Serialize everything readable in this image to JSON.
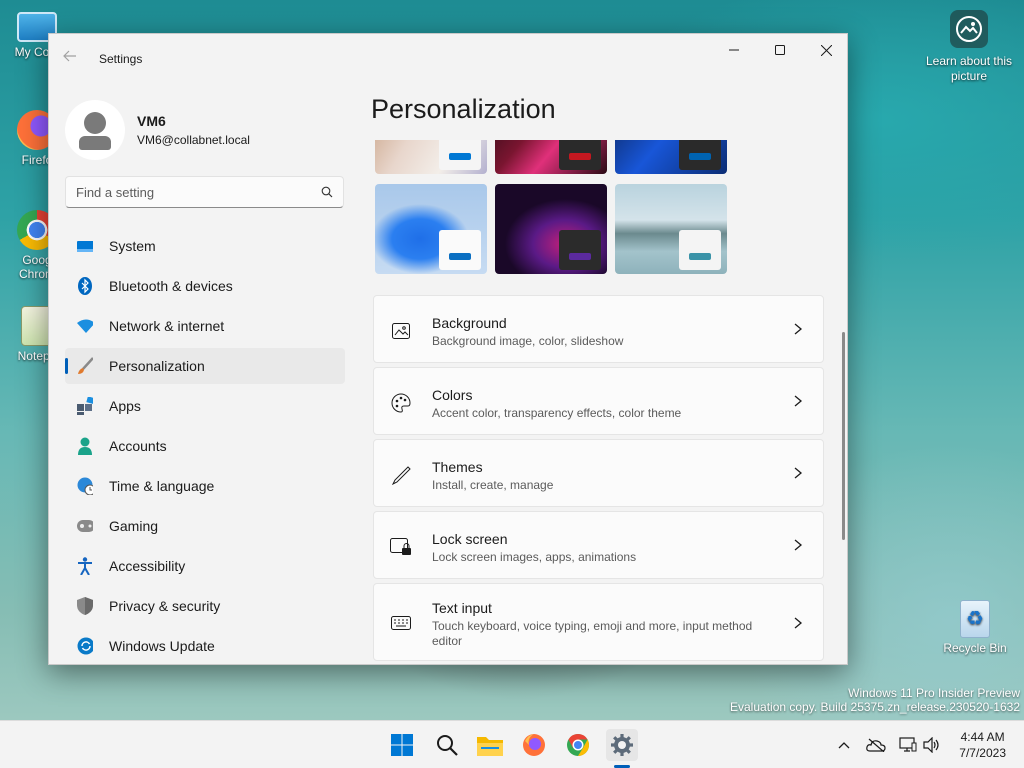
{
  "desktop": {
    "icons": [
      {
        "label": "My Com"
      },
      {
        "label": "Firefo"
      },
      {
        "label": "Goog"
      },
      {
        "label": "Chrom"
      },
      {
        "label": "Notepa"
      }
    ],
    "learn_label": "Learn about this picture",
    "recycle_label": "Recycle Bin",
    "watermark_line1": "Windows 11 Pro Insider Preview",
    "watermark_line2": "Evaluation copy. Build 25375.zn_release.230520-1632"
  },
  "window": {
    "title": "Settings",
    "controls": {
      "minimize": "minimize-icon",
      "maximize": "maximize-icon",
      "close": "close-icon"
    }
  },
  "profile": {
    "name": "VM6",
    "email": "VM6@collabnet.local"
  },
  "search": {
    "placeholder": "Find a setting"
  },
  "nav": {
    "items": [
      {
        "label": "System",
        "icon": "system-icon",
        "color": "#0078d4"
      },
      {
        "label": "Bluetooth & devices",
        "icon": "bluetooth-icon",
        "color": "#0067c0"
      },
      {
        "label": "Network & internet",
        "icon": "wifi-icon",
        "color": "#1b8fe0"
      },
      {
        "label": "Personalization",
        "icon": "brush-icon",
        "color": "#e07a2e"
      },
      {
        "label": "Apps",
        "icon": "apps-icon",
        "color": "#4a5b70"
      },
      {
        "label": "Accounts",
        "icon": "accounts-icon",
        "color": "#1aa38a"
      },
      {
        "label": "Time & language",
        "icon": "globe-clock-icon",
        "color": "#2b88d8"
      },
      {
        "label": "Gaming",
        "icon": "gamepad-icon",
        "color": "#6e6e6e"
      },
      {
        "label": "Accessibility",
        "icon": "accessibility-icon",
        "color": "#1565c0"
      },
      {
        "label": "Privacy & security",
        "icon": "shield-icon",
        "color": "#7b7b7b"
      },
      {
        "label": "Windows Update",
        "icon": "update-icon",
        "color": "#0a7ac8"
      }
    ],
    "active_index": 3
  },
  "main": {
    "title": "Personalization",
    "cards": [
      {
        "title": "Background",
        "subtitle": "Background image, color, slideshow",
        "icon": "image-icon"
      },
      {
        "title": "Colors",
        "subtitle": "Accent color, transparency effects, color theme",
        "icon": "palette-icon"
      },
      {
        "title": "Themes",
        "subtitle": "Install, create, manage",
        "icon": "pen-icon"
      },
      {
        "title": "Lock screen",
        "subtitle": "Lock screen images, apps, animations",
        "icon": "lock-screen-icon"
      },
      {
        "title": "Text input",
        "subtitle": "Touch keyboard, voice typing, emoji and more, input method editor",
        "icon": "keyboard-icon"
      }
    ],
    "themes": [
      {
        "name": "theme-1",
        "accent": "#0078d4"
      },
      {
        "name": "theme-2",
        "accent": "#c41820"
      },
      {
        "name": "theme-3",
        "accent": "#0063b1"
      },
      {
        "name": "theme-4",
        "accent": "#0a6fc2"
      },
      {
        "name": "theme-5",
        "accent": "#5b2a9e"
      },
      {
        "name": "theme-6",
        "accent": "#3a93a8"
      }
    ]
  },
  "taskbar": {
    "apps": [
      "start-icon",
      "search-icon",
      "file-explorer-icon",
      "firefox-icon",
      "chrome-icon",
      "settings-icon"
    ],
    "tray": [
      "chevron-up-icon",
      "onedrive-icon",
      "network-icon",
      "volume-icon"
    ],
    "time": "4:44 AM",
    "date": "7/7/2023"
  }
}
